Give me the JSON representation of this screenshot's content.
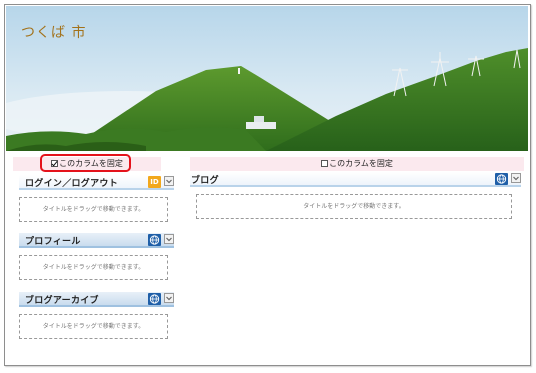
{
  "site": {
    "title": "つくば 市"
  },
  "columns": {
    "left_lock_label": "このカラムを固定",
    "right_lock_label": "このカラムを固定"
  },
  "widgets": {
    "login": {
      "title": "ログイン／ログアウト",
      "badge": "ID",
      "drop_hint": "タイトルをドラッグで移動できます。"
    },
    "profile": {
      "title": "プロフィール",
      "drop_hint": "タイトルをドラッグで移動できます。"
    },
    "archive": {
      "title": "ブログアーカイブ",
      "drop_hint": "タイトルをドラッグで移動できます。"
    },
    "blog": {
      "title": "ブログ",
      "drop_hint": "タイトルをドラッグで移動できます。"
    }
  },
  "colors": {
    "highlight": "#e4121b",
    "title_text": "#a3721b",
    "badge": "#f2a81d",
    "globe": "#1f5fa8"
  },
  "icons": [
    "id-icon",
    "globe-icon",
    "dropdown-icon",
    "checkbox-icon"
  ]
}
